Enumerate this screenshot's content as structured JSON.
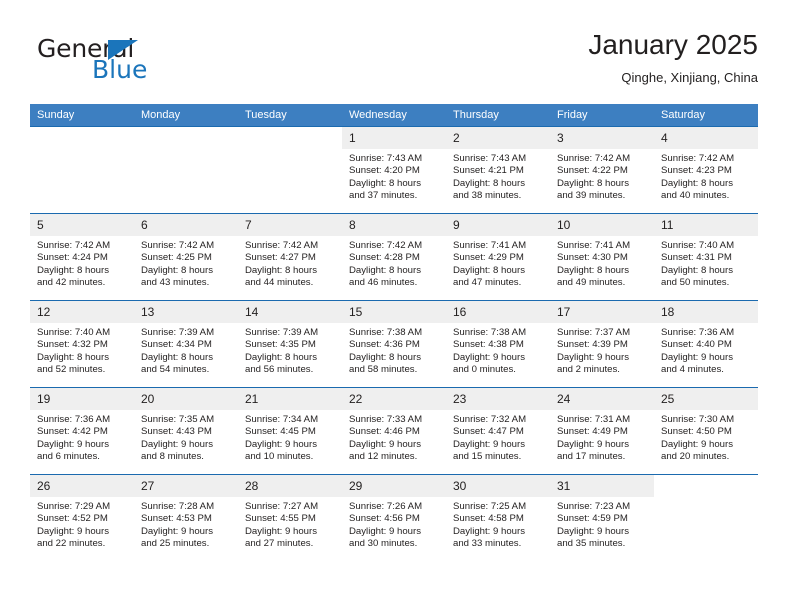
{
  "brand": {
    "name_part1": "General",
    "name_part2": "Blue",
    "triangle_color": "#1b75bb"
  },
  "header": {
    "title": "January 2025",
    "subtitle": "Qinghe, Xinjiang, China"
  },
  "theme": {
    "header_bar_color": "#3d7fc1",
    "row_separator_color": "#1b6aaf",
    "daynum_bg": "#efefef",
    "text_color": "#221f1f"
  },
  "weekday_headers": [
    "Sunday",
    "Monday",
    "Tuesday",
    "Wednesday",
    "Thursday",
    "Friday",
    "Saturday"
  ],
  "weeks": [
    [
      {
        "day": "",
        "sunrise": "",
        "sunset": "",
        "daylight_line1": "",
        "daylight_line2": "",
        "empty": true
      },
      {
        "day": "",
        "sunrise": "",
        "sunset": "",
        "daylight_line1": "",
        "daylight_line2": "",
        "empty": true
      },
      {
        "day": "",
        "sunrise": "",
        "sunset": "",
        "daylight_line1": "",
        "daylight_line2": "",
        "empty": true
      },
      {
        "day": "1",
        "sunrise": "Sunrise: 7:43 AM",
        "sunset": "Sunset: 4:20 PM",
        "daylight_line1": "Daylight: 8 hours",
        "daylight_line2": "and 37 minutes."
      },
      {
        "day": "2",
        "sunrise": "Sunrise: 7:43 AM",
        "sunset": "Sunset: 4:21 PM",
        "daylight_line1": "Daylight: 8 hours",
        "daylight_line2": "and 38 minutes."
      },
      {
        "day": "3",
        "sunrise": "Sunrise: 7:42 AM",
        "sunset": "Sunset: 4:22 PM",
        "daylight_line1": "Daylight: 8 hours",
        "daylight_line2": "and 39 minutes."
      },
      {
        "day": "4",
        "sunrise": "Sunrise: 7:42 AM",
        "sunset": "Sunset: 4:23 PM",
        "daylight_line1": "Daylight: 8 hours",
        "daylight_line2": "and 40 minutes."
      }
    ],
    [
      {
        "day": "5",
        "sunrise": "Sunrise: 7:42 AM",
        "sunset": "Sunset: 4:24 PM",
        "daylight_line1": "Daylight: 8 hours",
        "daylight_line2": "and 42 minutes."
      },
      {
        "day": "6",
        "sunrise": "Sunrise: 7:42 AM",
        "sunset": "Sunset: 4:25 PM",
        "daylight_line1": "Daylight: 8 hours",
        "daylight_line2": "and 43 minutes."
      },
      {
        "day": "7",
        "sunrise": "Sunrise: 7:42 AM",
        "sunset": "Sunset: 4:27 PM",
        "daylight_line1": "Daylight: 8 hours",
        "daylight_line2": "and 44 minutes."
      },
      {
        "day": "8",
        "sunrise": "Sunrise: 7:42 AM",
        "sunset": "Sunset: 4:28 PM",
        "daylight_line1": "Daylight: 8 hours",
        "daylight_line2": "and 46 minutes."
      },
      {
        "day": "9",
        "sunrise": "Sunrise: 7:41 AM",
        "sunset": "Sunset: 4:29 PM",
        "daylight_line1": "Daylight: 8 hours",
        "daylight_line2": "and 47 minutes."
      },
      {
        "day": "10",
        "sunrise": "Sunrise: 7:41 AM",
        "sunset": "Sunset: 4:30 PM",
        "daylight_line1": "Daylight: 8 hours",
        "daylight_line2": "and 49 minutes."
      },
      {
        "day": "11",
        "sunrise": "Sunrise: 7:40 AM",
        "sunset": "Sunset: 4:31 PM",
        "daylight_line1": "Daylight: 8 hours",
        "daylight_line2": "and 50 minutes."
      }
    ],
    [
      {
        "day": "12",
        "sunrise": "Sunrise: 7:40 AM",
        "sunset": "Sunset: 4:32 PM",
        "daylight_line1": "Daylight: 8 hours",
        "daylight_line2": "and 52 minutes."
      },
      {
        "day": "13",
        "sunrise": "Sunrise: 7:39 AM",
        "sunset": "Sunset: 4:34 PM",
        "daylight_line1": "Daylight: 8 hours",
        "daylight_line2": "and 54 minutes."
      },
      {
        "day": "14",
        "sunrise": "Sunrise: 7:39 AM",
        "sunset": "Sunset: 4:35 PM",
        "daylight_line1": "Daylight: 8 hours",
        "daylight_line2": "and 56 minutes."
      },
      {
        "day": "15",
        "sunrise": "Sunrise: 7:38 AM",
        "sunset": "Sunset: 4:36 PM",
        "daylight_line1": "Daylight: 8 hours",
        "daylight_line2": "and 58 minutes."
      },
      {
        "day": "16",
        "sunrise": "Sunrise: 7:38 AM",
        "sunset": "Sunset: 4:38 PM",
        "daylight_line1": "Daylight: 9 hours",
        "daylight_line2": "and 0 minutes."
      },
      {
        "day": "17",
        "sunrise": "Sunrise: 7:37 AM",
        "sunset": "Sunset: 4:39 PM",
        "daylight_line1": "Daylight: 9 hours",
        "daylight_line2": "and 2 minutes."
      },
      {
        "day": "18",
        "sunrise": "Sunrise: 7:36 AM",
        "sunset": "Sunset: 4:40 PM",
        "daylight_line1": "Daylight: 9 hours",
        "daylight_line2": "and 4 minutes."
      }
    ],
    [
      {
        "day": "19",
        "sunrise": "Sunrise: 7:36 AM",
        "sunset": "Sunset: 4:42 PM",
        "daylight_line1": "Daylight: 9 hours",
        "daylight_line2": "and 6 minutes."
      },
      {
        "day": "20",
        "sunrise": "Sunrise: 7:35 AM",
        "sunset": "Sunset: 4:43 PM",
        "daylight_line1": "Daylight: 9 hours",
        "daylight_line2": "and 8 minutes."
      },
      {
        "day": "21",
        "sunrise": "Sunrise: 7:34 AM",
        "sunset": "Sunset: 4:45 PM",
        "daylight_line1": "Daylight: 9 hours",
        "daylight_line2": "and 10 minutes."
      },
      {
        "day": "22",
        "sunrise": "Sunrise: 7:33 AM",
        "sunset": "Sunset: 4:46 PM",
        "daylight_line1": "Daylight: 9 hours",
        "daylight_line2": "and 12 minutes."
      },
      {
        "day": "23",
        "sunrise": "Sunrise: 7:32 AM",
        "sunset": "Sunset: 4:47 PM",
        "daylight_line1": "Daylight: 9 hours",
        "daylight_line2": "and 15 minutes."
      },
      {
        "day": "24",
        "sunrise": "Sunrise: 7:31 AM",
        "sunset": "Sunset: 4:49 PM",
        "daylight_line1": "Daylight: 9 hours",
        "daylight_line2": "and 17 minutes."
      },
      {
        "day": "25",
        "sunrise": "Sunrise: 7:30 AM",
        "sunset": "Sunset: 4:50 PM",
        "daylight_line1": "Daylight: 9 hours",
        "daylight_line2": "and 20 minutes."
      }
    ],
    [
      {
        "day": "26",
        "sunrise": "Sunrise: 7:29 AM",
        "sunset": "Sunset: 4:52 PM",
        "daylight_line1": "Daylight: 9 hours",
        "daylight_line2": "and 22 minutes."
      },
      {
        "day": "27",
        "sunrise": "Sunrise: 7:28 AM",
        "sunset": "Sunset: 4:53 PM",
        "daylight_line1": "Daylight: 9 hours",
        "daylight_line2": "and 25 minutes."
      },
      {
        "day": "28",
        "sunrise": "Sunrise: 7:27 AM",
        "sunset": "Sunset: 4:55 PM",
        "daylight_line1": "Daylight: 9 hours",
        "daylight_line2": "and 27 minutes."
      },
      {
        "day": "29",
        "sunrise": "Sunrise: 7:26 AM",
        "sunset": "Sunset: 4:56 PM",
        "daylight_line1": "Daylight: 9 hours",
        "daylight_line2": "and 30 minutes."
      },
      {
        "day": "30",
        "sunrise": "Sunrise: 7:25 AM",
        "sunset": "Sunset: 4:58 PM",
        "daylight_line1": "Daylight: 9 hours",
        "daylight_line2": "and 33 minutes."
      },
      {
        "day": "31",
        "sunrise": "Sunrise: 7:23 AM",
        "sunset": "Sunset: 4:59 PM",
        "daylight_line1": "Daylight: 9 hours",
        "daylight_line2": "and 35 minutes."
      },
      {
        "day": "",
        "sunrise": "",
        "sunset": "",
        "daylight_line1": "",
        "daylight_line2": "",
        "empty": true
      }
    ]
  ]
}
